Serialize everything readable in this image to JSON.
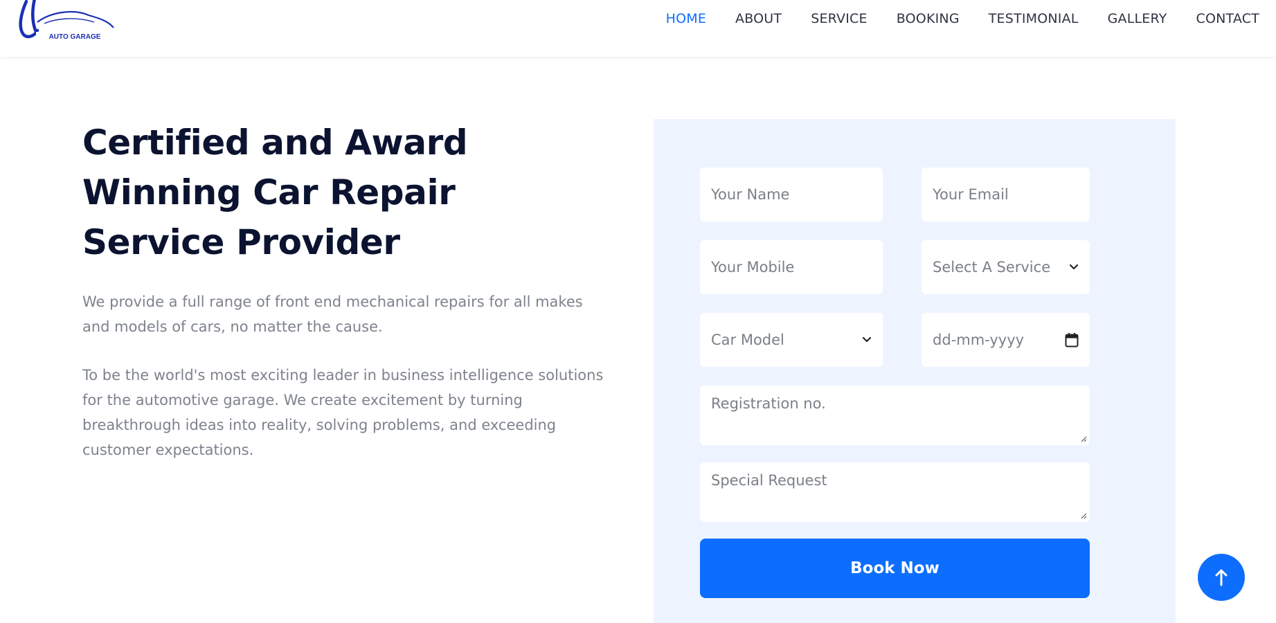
{
  "brand": {
    "logo_text": "AUTO GARAGE"
  },
  "nav": {
    "items": [
      {
        "label": "HOME",
        "active": true
      },
      {
        "label": "ABOUT"
      },
      {
        "label": "SERVICE"
      },
      {
        "label": "BOOKING"
      },
      {
        "label": "TESTIMONIAL"
      },
      {
        "label": "GALLERY"
      },
      {
        "label": "CONTACT"
      }
    ]
  },
  "intro": {
    "title": "Certified and Award Winning Car Repair Service Provider",
    "paragraph_1": "We provide a full range of front end mechanical repairs for all makes and models of cars, no matter the cause.",
    "paragraph_2": "To be the world's most exciting leader in business intelligence solutions for the automotive garage. We create excitement by turning breakthrough ideas into reality, solving problems, and exceeding customer expectations."
  },
  "booking_form": {
    "name_placeholder": "Your Name",
    "email_placeholder": "Your Email",
    "mobile_placeholder": "Your Mobile",
    "service_select": "Select A Service",
    "car_model_select": "Car Model",
    "date_placeholder": "dd-mm-yyyy",
    "registration_placeholder": "Registration no.",
    "special_request_placeholder": "Special Request",
    "submit_label": "Book Now"
  },
  "colors": {
    "accent": "#0d6efd",
    "heading": "#0b1330",
    "body_text": "#7d828c",
    "panel_bg": "#eef4ff"
  },
  "icons": {
    "select_arrow": "chevron-down-icon",
    "date_picker": "calendar-icon",
    "back_to_top": "arrow-up-icon"
  }
}
